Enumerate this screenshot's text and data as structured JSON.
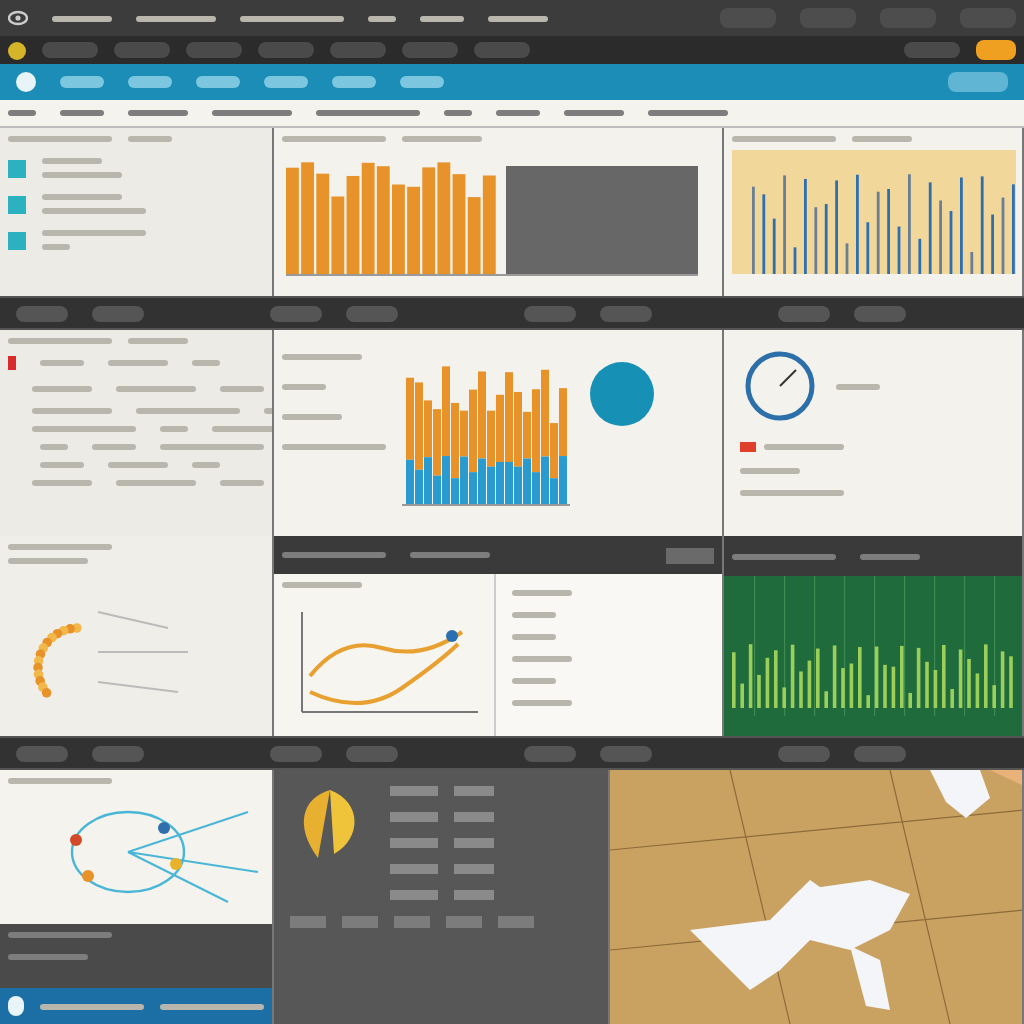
{
  "rows": [
    {
      "kind": "panels",
      "panels": [
        {
          "kind": "list"
        },
        {
          "kind": "bar-chart"
        },
        {
          "kind": "spike-chart"
        }
      ]
    },
    {
      "kind": "toolbar"
    },
    {
      "kind": "panels",
      "panels": [
        {
          "kind": "table"
        },
        {
          "kind": "stacked-chart"
        },
        {
          "kind": "ring-chart"
        }
      ]
    },
    {
      "kind": "panels",
      "panels": [
        {
          "kind": "arc-chart"
        },
        {
          "kind": "line-chart"
        },
        {
          "kind": "green-chart"
        }
      ]
    },
    {
      "kind": "toolbar"
    },
    {
      "kind": "panels",
      "panels": [
        {
          "kind": "network-chart"
        },
        {
          "kind": "pie-panel"
        },
        {
          "kind": "map"
        }
      ]
    }
  ]
}
